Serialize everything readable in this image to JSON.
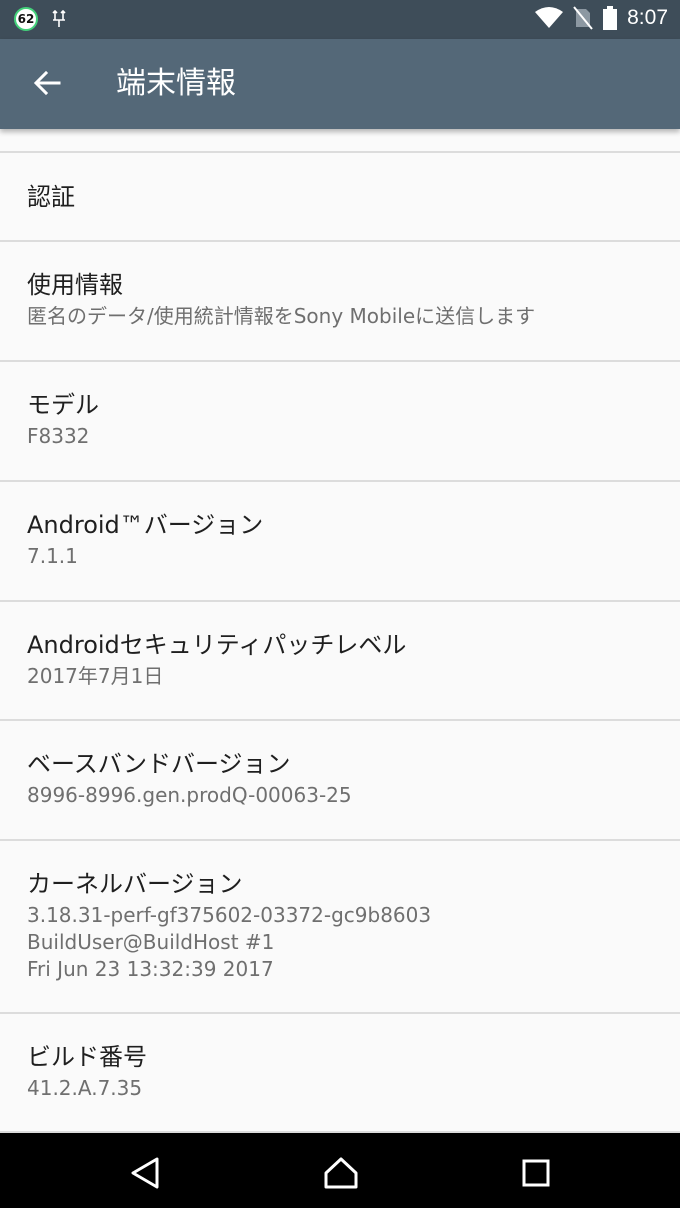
{
  "status_bar": {
    "notification_count": "62",
    "time": "8:07",
    "icons": [
      "notification-badge-icon",
      "usb-debug-icon",
      "wifi-icon",
      "no-sim-icon",
      "battery-icon"
    ]
  },
  "app_bar": {
    "title": "端末情報",
    "back_icon": "arrow-back-icon"
  },
  "items": [
    {
      "title": "認証"
    },
    {
      "title": "使用情報",
      "summary": "匿名のデータ/使用統計情報をSony Mobileに送信します"
    },
    {
      "title": "モデル",
      "summary": "F8332"
    },
    {
      "title": "Android™バージョン",
      "summary": "7.1.1"
    },
    {
      "title": "Androidセキュリティパッチレベル",
      "summary": "2017年7月1日"
    },
    {
      "title": "ベースバンドバージョン",
      "summary": "8996-8996.gen.prodQ-00063-25"
    },
    {
      "title": "カーネルバージョン",
      "summary_lines": [
        "3.18.31-perf-gf375602-03372-gc9b8603",
        "BuildUser@BuildHost #1",
        "Fri Jun 23 13:32:39 2017"
      ]
    },
    {
      "title": "ビルド番号",
      "summary": "41.2.A.7.35"
    }
  ],
  "nav_bar": {
    "icons": [
      "back-triangle-icon",
      "home-icon",
      "recents-icon"
    ]
  },
  "colors": {
    "status_bar": "#3e4d59",
    "app_bar": "#546878",
    "background": "#fafafa",
    "divider": "#dcdcdc"
  }
}
